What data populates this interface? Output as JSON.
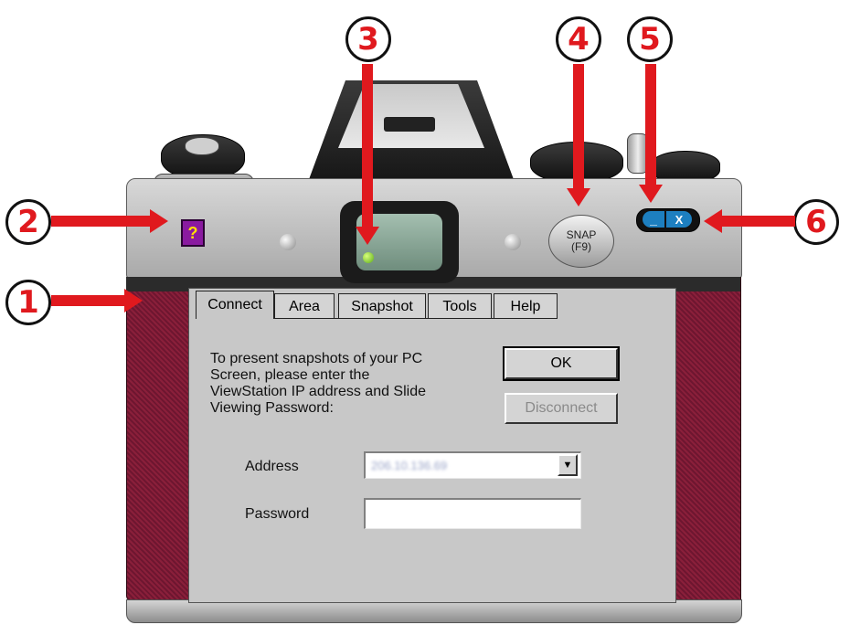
{
  "callouts": [
    "1",
    "2",
    "3",
    "4",
    "5",
    "6"
  ],
  "colors": {
    "leather": "#7a1a33",
    "callout_red": "#e0191e",
    "panel": "#c8c8c8"
  },
  "buttons": {
    "help_icon": "?",
    "snap_label": "SNAP",
    "snap_key": "(F9)",
    "minimize": "_",
    "close": "X"
  },
  "tabs": [
    {
      "label": "Connect",
      "active": true
    },
    {
      "label": "Area",
      "active": false
    },
    {
      "label": "Snapshot",
      "active": false
    },
    {
      "label": "Tools",
      "active": false
    },
    {
      "label": "Help",
      "active": false
    }
  ],
  "connect": {
    "description": "To present snapshots of your PC\nScreen, please enter the\nViewStation IP address and Slide\nViewing Password:",
    "ok_label": "OK",
    "disconnect_label": "Disconnect",
    "address_label": "Address",
    "address_value": "206.10.136.69",
    "password_label": "Password",
    "password_value": ""
  }
}
